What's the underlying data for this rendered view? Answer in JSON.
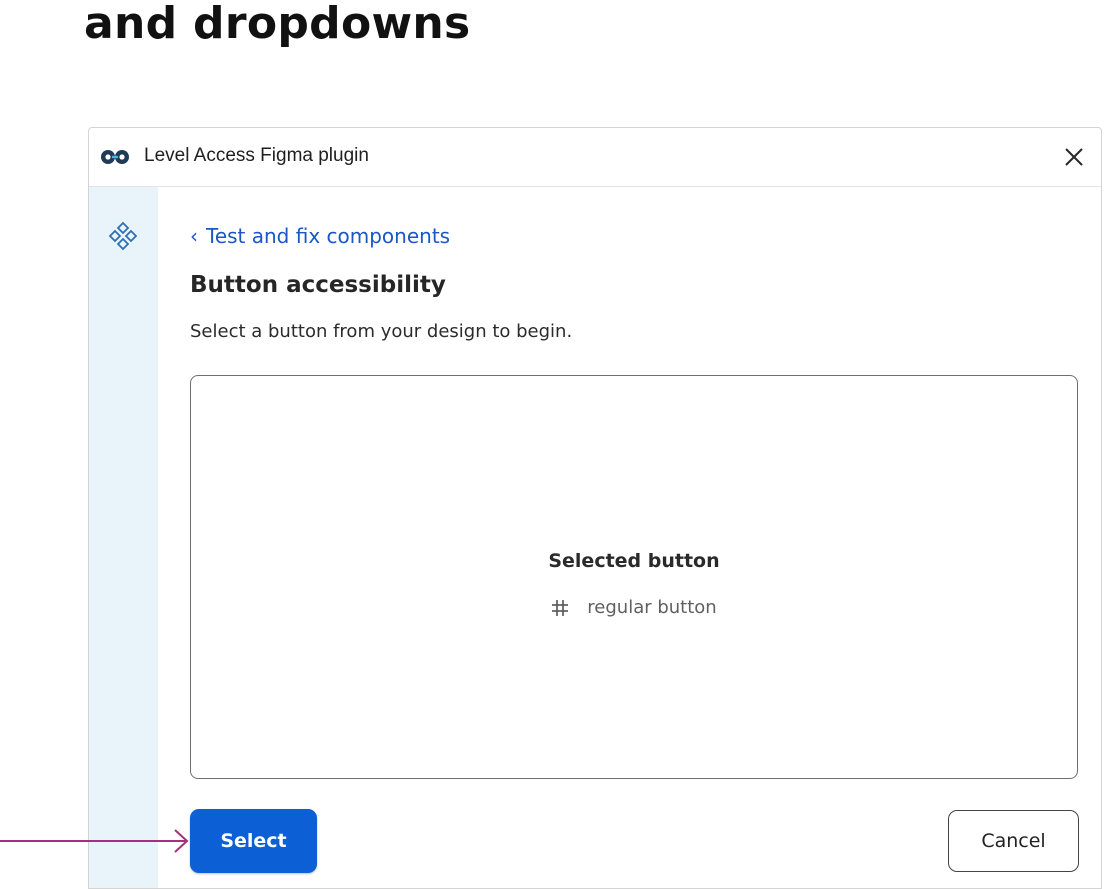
{
  "slide": {
    "title": "and dropdowns"
  },
  "plugin": {
    "title": "Level Access Figma plugin",
    "logo_icon": "level-access-logo-icon",
    "close_icon": "close-icon",
    "rail_icon": "components-icon"
  },
  "panel": {
    "back_link": "Test and fix components",
    "heading": "Button accessibility",
    "instructions": "Select a button from your design to begin.",
    "selection": {
      "title": "Selected button",
      "item_icon": "frame-icon",
      "item_label": "regular button"
    },
    "actions": {
      "select_label": "Select",
      "cancel_label": "Cancel"
    }
  },
  "colors": {
    "primary": "#0d5fd6",
    "link": "#1a57c4",
    "rail_bg": "#e8f4fa",
    "annotation_arrow": "#a3307a"
  }
}
